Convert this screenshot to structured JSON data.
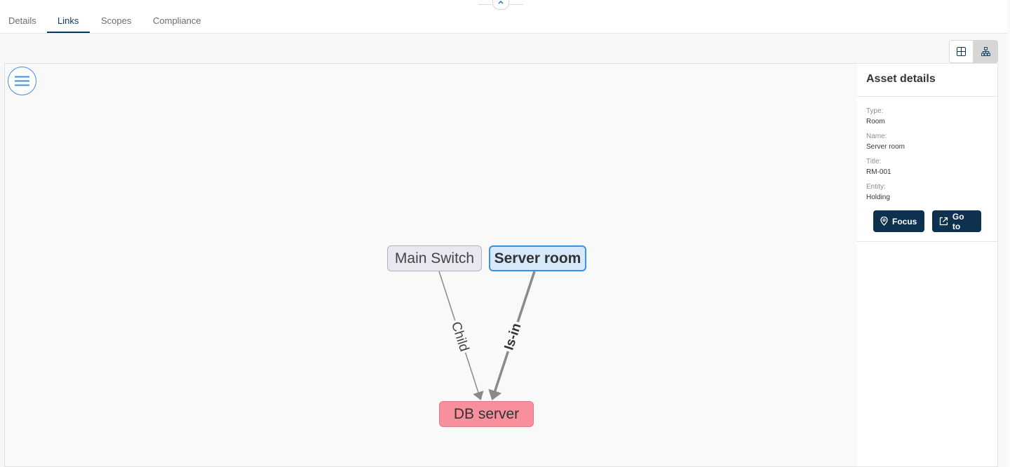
{
  "tabs": [
    {
      "label": "Details",
      "active": false
    },
    {
      "label": "Links",
      "active": true
    },
    {
      "label": "Scopes",
      "active": false
    },
    {
      "label": "Compliance",
      "active": false
    }
  ],
  "view_toggle": {
    "items": [
      {
        "icon": "table-grid-icon",
        "active": false
      },
      {
        "icon": "hierarchy-icon",
        "active": true
      }
    ]
  },
  "graph": {
    "menu_icon": "menu-icon",
    "nodes": {
      "main_switch": "Main Switch",
      "server_room": "Server room",
      "db_server": "DB server"
    },
    "edges": {
      "child": "Child",
      "is_in": "Is-in"
    }
  },
  "details": {
    "title": "Asset details",
    "fields": [
      {
        "label": "Type:",
        "value": "Room"
      },
      {
        "label": "Name:",
        "value": "Server room"
      },
      {
        "label": "Title:",
        "value": "RM-001"
      },
      {
        "label": "Entity:",
        "value": "Holding"
      }
    ],
    "focus_label": "Focus",
    "goto_label": "Go to"
  },
  "colors": {
    "accent": "#0a3b5c",
    "button_bg": "#0e3150",
    "selected_node_border": "#3f8fe0",
    "selected_node_bg": "#d6e9fb",
    "target_node_bg": "#f78f9c",
    "neutral_node_bg": "#e8e8f0"
  }
}
